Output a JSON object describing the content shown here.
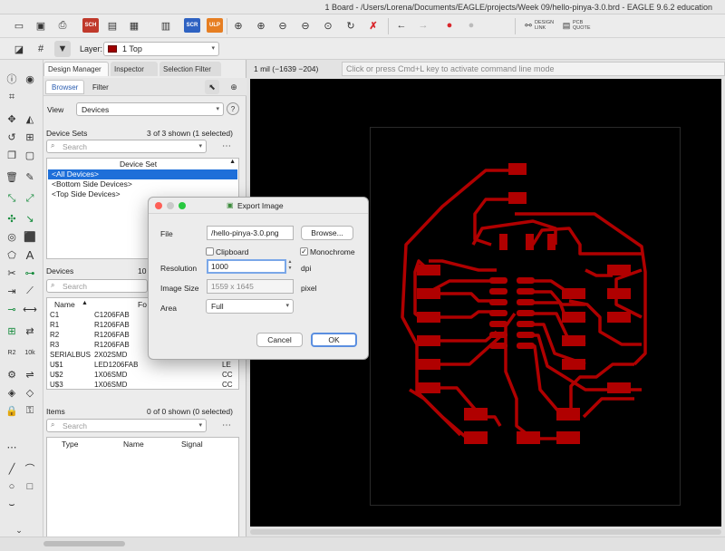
{
  "window": {
    "title": "1 Board - /Users/Lorena/Documents/EAGLE/projects/Week 09/hello-pinya-3.0.brd - EAGLE 9.6.2 education"
  },
  "toolbar": {
    "sch_badge": "SCH",
    "scr_badge": "SCR",
    "ulp_badge": "ULP",
    "design_link": "DESIGN LINK",
    "pcb_quote": "PCB QUOTE",
    "colors": {
      "sch": "#c0392b",
      "scr": "#2e62c2",
      "ulp": "#e67e22",
      "stop": "#d9262b"
    }
  },
  "layerbar": {
    "label": "Layer:",
    "value": "1 Top",
    "swatch": "#a00000"
  },
  "panel": {
    "tabs": [
      "Design Manager",
      "Inspector",
      "Selection Filter"
    ],
    "subtabs": [
      "Browser",
      "Filter"
    ],
    "view_label": "View",
    "view_value": "Devices",
    "device_sets": {
      "title": "Device Sets",
      "count": "3 of 3 shown (1 selected)",
      "search_placeholder": "Search",
      "column": "Device Set",
      "items": [
        "<All Devices>",
        "<Bottom Side Devices>",
        "<Top Side Devices>"
      ]
    },
    "devices": {
      "title": "Devices",
      "count": "10",
      "search_placeholder": "Search",
      "col_name": "Name",
      "col_footprint": "Fo",
      "rows": [
        {
          "name": "C1",
          "footprint": "C1206FAB",
          "extra": ""
        },
        {
          "name": "R1",
          "footprint": "R1206FAB",
          "extra": ""
        },
        {
          "name": "R2",
          "footprint": "R1206FAB",
          "extra": ""
        },
        {
          "name": "R3",
          "footprint": "R1206FAB",
          "extra": ""
        },
        {
          "name": "SERIALBUS",
          "footprint": "2X02SMD",
          "extra": ""
        },
        {
          "name": "U$1",
          "footprint": "LED1206FAB",
          "extra": "LE"
        },
        {
          "name": "U$2",
          "footprint": "1X06SMD",
          "extra": "CC"
        },
        {
          "name": "U$3",
          "footprint": "1X06SMD",
          "extra": "CC"
        }
      ]
    },
    "items": {
      "title": "Items",
      "count": "0 of 0 shown (0 selected)",
      "search_placeholder": "Search",
      "columns": [
        "Type",
        "Name",
        "Signal"
      ]
    }
  },
  "canvas": {
    "coordinate": "1 mil (−1639 −204)",
    "command_placeholder": "Click or press Cmd+L key to activate command line mode",
    "trace_color": "#b00000"
  },
  "export_dialog": {
    "title": "Export Image",
    "file_label": "File",
    "file_value": "/hello-pinya-3.0.png",
    "browse_label": "Browse...",
    "clipboard_label": "Clipboard",
    "clipboard_checked": false,
    "monochrome_label": "Monochrome",
    "monochrome_checked": true,
    "resolution_label": "Resolution",
    "resolution_value": "1000",
    "resolution_unit": "dpi",
    "image_size_label": "Image Size",
    "image_size_value": "1559 x 1645",
    "image_size_unit": "pixel",
    "area_label": "Area",
    "area_value": "Full",
    "cancel_label": "Cancel",
    "ok_label": "OK"
  }
}
